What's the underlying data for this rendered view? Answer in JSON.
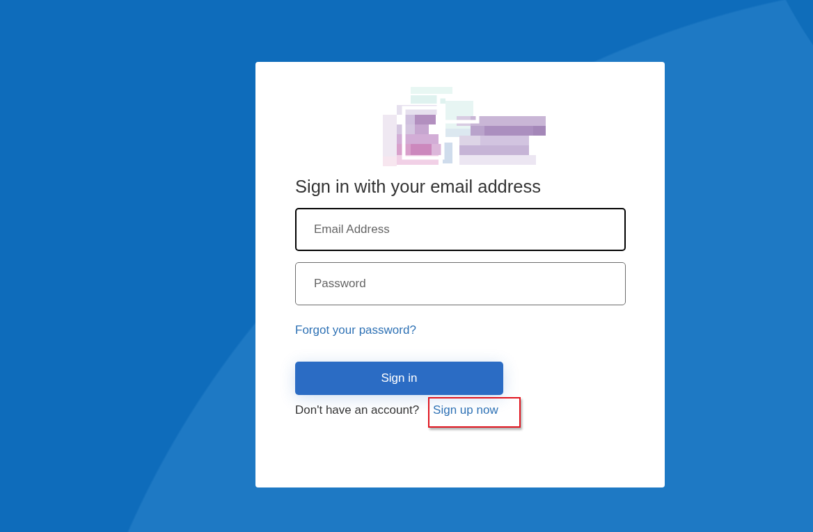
{
  "heading": "Sign in with your email address",
  "fields": [
    {
      "placeholder": "Email Address",
      "focused": true
    },
    {
      "placeholder": "Password",
      "focused": false
    }
  ],
  "forgot_link": "Forgot your password?",
  "submit_button": "Sign in",
  "signup": {
    "prompt": "Don't have an account?",
    "link": "Sign up now",
    "highlighted": true
  }
}
